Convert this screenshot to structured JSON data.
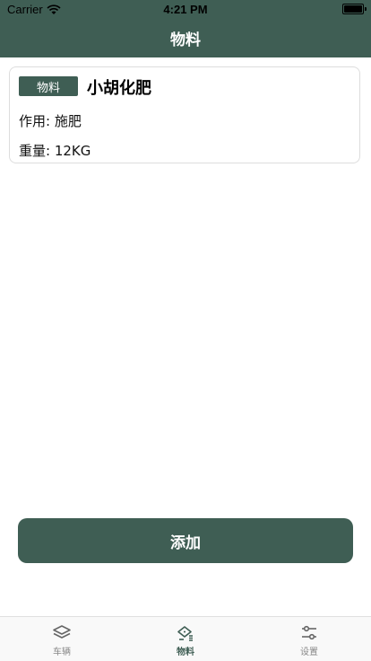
{
  "status": {
    "carrier": "Carrier",
    "time": "4:21 PM"
  },
  "nav": {
    "title": "物料"
  },
  "item": {
    "tag": "物料",
    "name": "小胡化肥",
    "line1": "作用: 施肥",
    "line2": "重量: 12KG"
  },
  "add_button": {
    "label": "添加"
  },
  "tabs": [
    {
      "label": "车辆",
      "icon": "layers-icon"
    },
    {
      "label": "物料",
      "icon": "material-icon"
    },
    {
      "label": "设置",
      "icon": "sliders-icon"
    }
  ],
  "colors": {
    "primary": "#3f5e54"
  }
}
